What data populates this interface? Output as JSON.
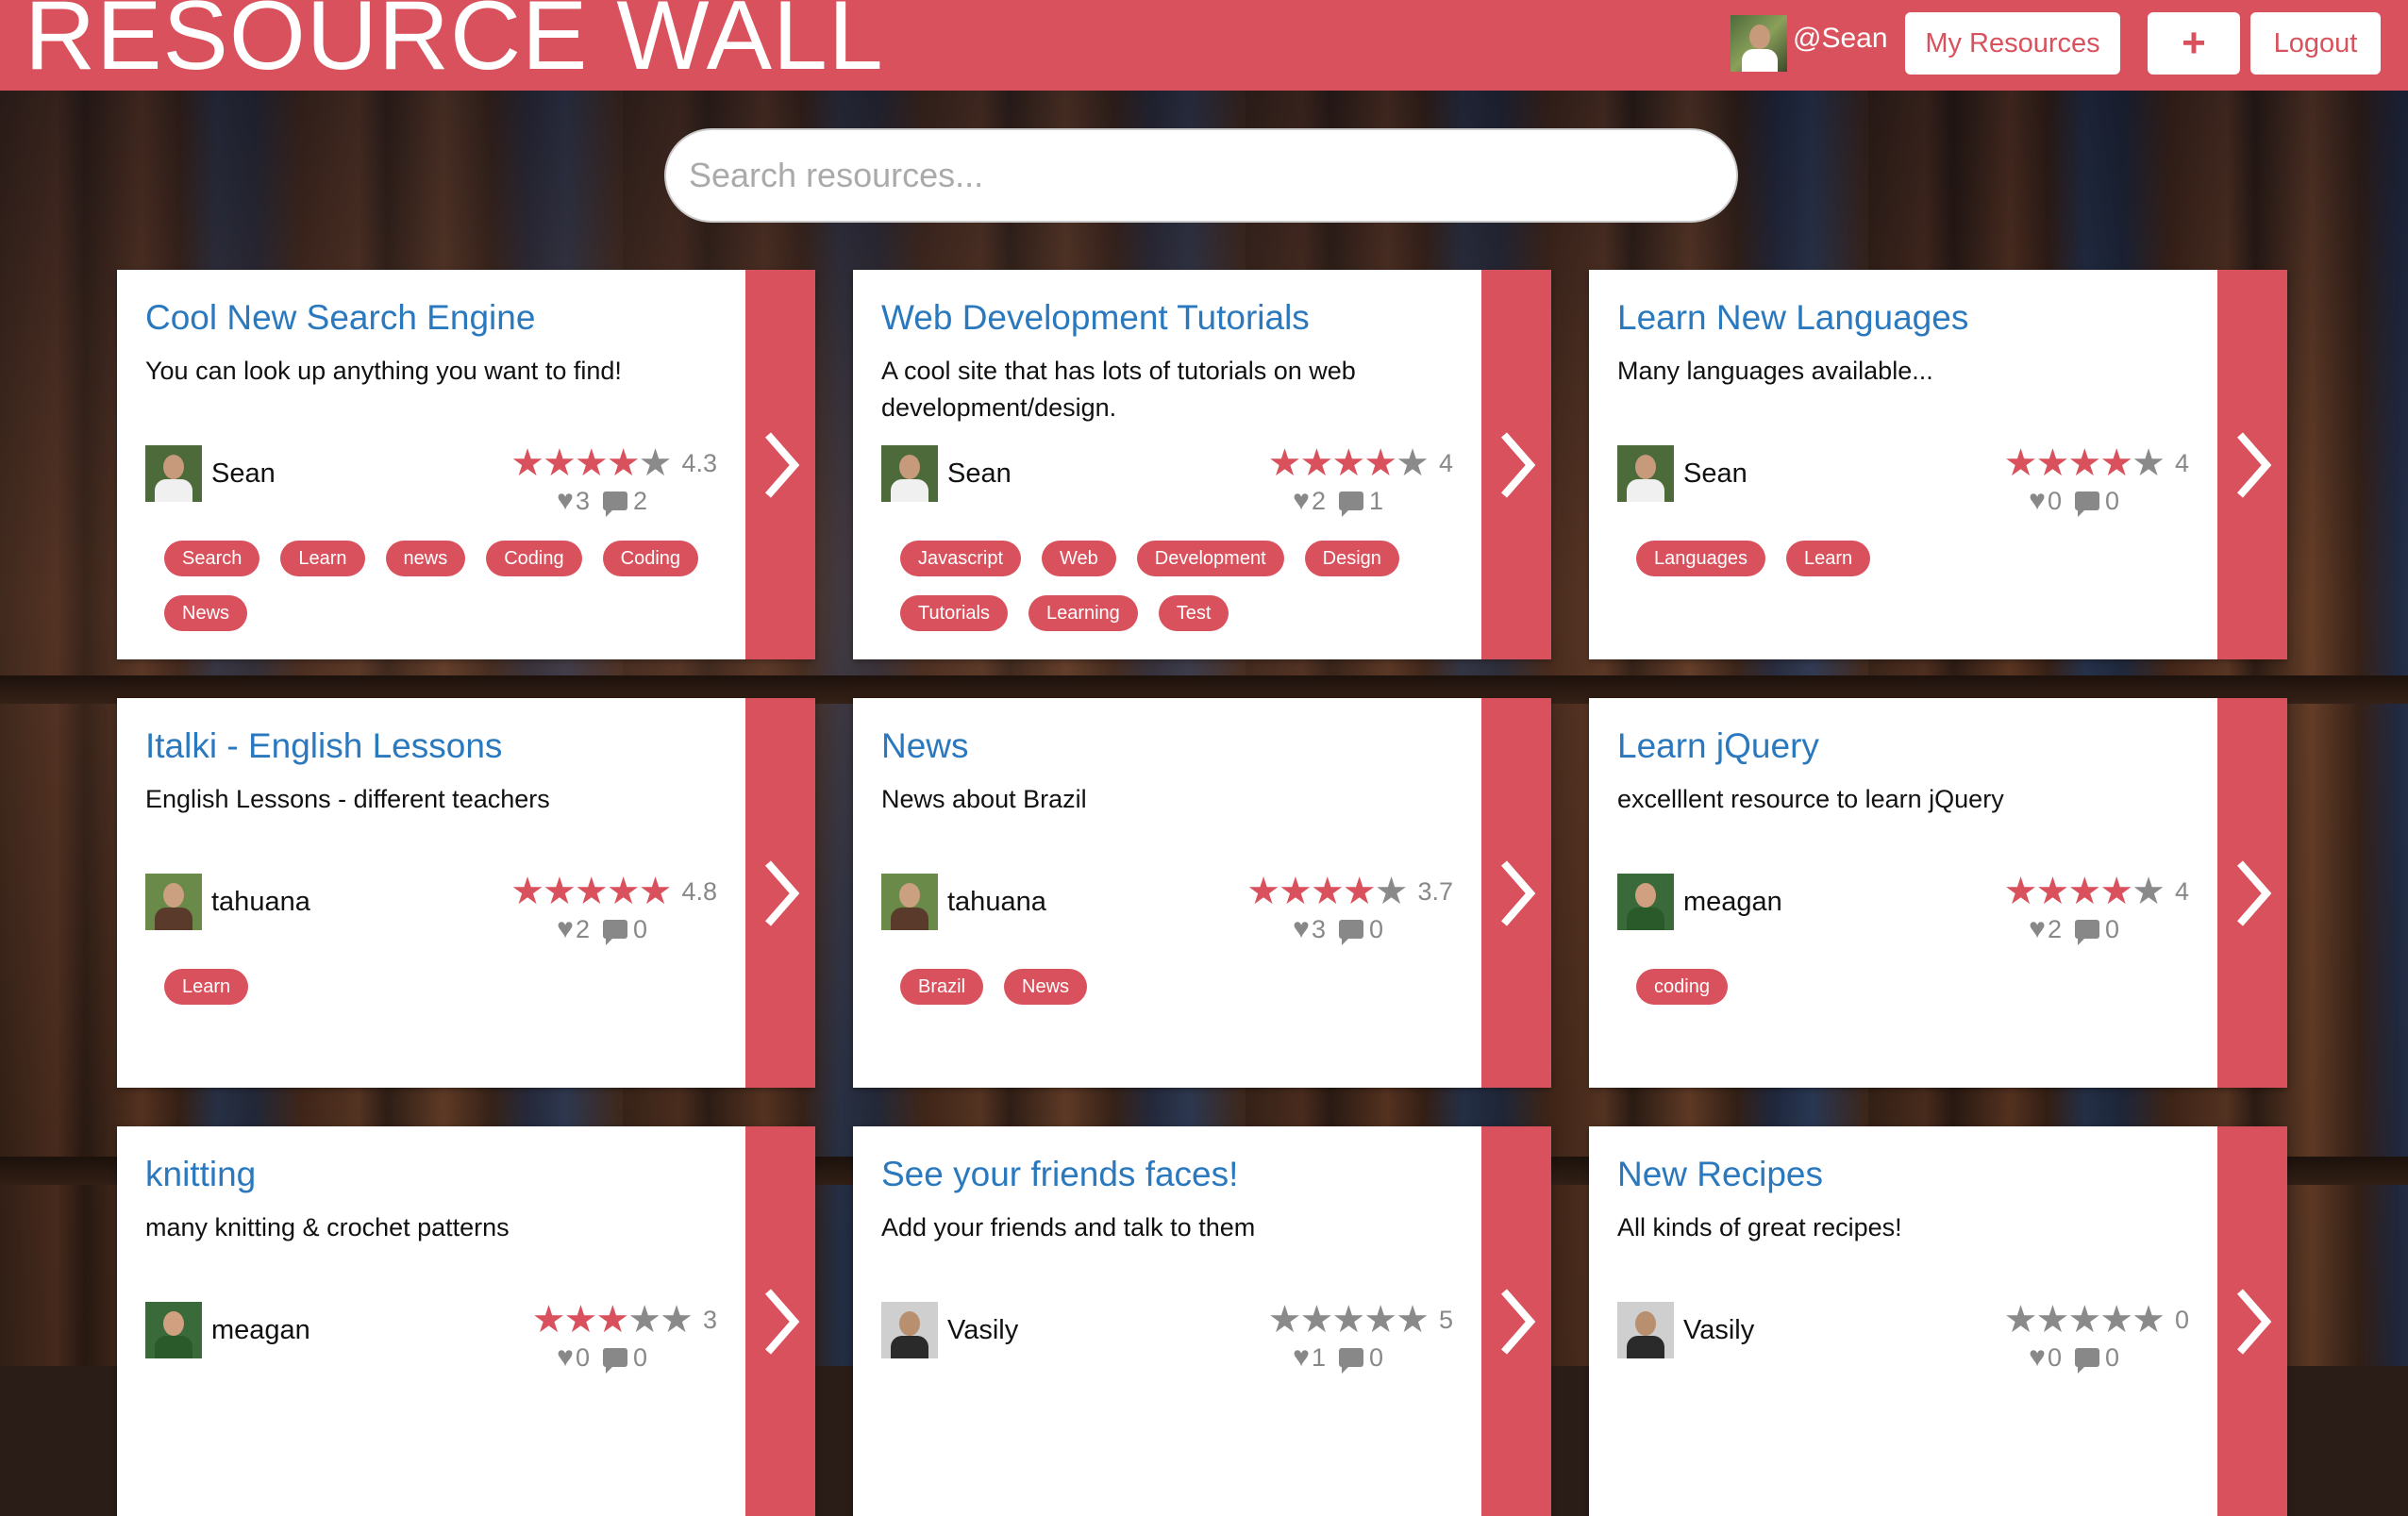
{
  "header": {
    "brand": "RESOURCE WALL",
    "user_handle": "@Sean",
    "my_resources_label": "My Resources",
    "add_label": "+",
    "logout_label": "Logout",
    "accent_color": "#d9515c"
  },
  "search": {
    "placeholder": "Search resources..."
  },
  "cards": [
    {
      "title": "Cool New Search Engine",
      "description": "You can look up anything you want to find!",
      "author": "Sean",
      "stars": 4,
      "rating": "4.3",
      "likes": "3",
      "comments": "2",
      "tags": [
        "Search",
        "Learn",
        "news",
        "Coding",
        "Coding",
        "News"
      ]
    },
    {
      "title": "Web Development Tutorials",
      "description": "A cool site that has lots of tutorials on web development/design.",
      "author": "Sean",
      "stars": 4,
      "rating": "4",
      "likes": "2",
      "comments": "1",
      "tags": [
        "Javascript",
        "Web",
        "Development",
        "Design",
        "Tutorials",
        "Learning",
        "Test"
      ]
    },
    {
      "title": "Learn New Languages",
      "description": "Many languages available...",
      "author": "Sean",
      "stars": 4,
      "rating": "4",
      "likes": "0",
      "comments": "0",
      "tags": [
        "Languages",
        "Learn"
      ]
    },
    {
      "title": "Italki - English Lessons",
      "description": "English Lessons - different teachers",
      "author": "tahuana",
      "stars": 5,
      "rating": "4.8",
      "likes": "2",
      "comments": "0",
      "tags": [
        "Learn"
      ]
    },
    {
      "title": "News",
      "description": "News about Brazil",
      "author": "tahuana",
      "stars": 4,
      "rating": "3.7",
      "likes": "3",
      "comments": "0",
      "tags": [
        "Brazil",
        "News"
      ]
    },
    {
      "title": "Learn jQuery",
      "description": "excelllent resource to learn jQuery",
      "author": "meagan",
      "stars": 4,
      "rating": "4",
      "likes": "2",
      "comments": "0",
      "tags": [
        "coding"
      ]
    },
    {
      "title": "knitting",
      "description": "many knitting & crochet patterns",
      "author": "meagan",
      "stars": 3,
      "rating": "3",
      "likes": "0",
      "comments": "0",
      "tags": []
    },
    {
      "title": "See your friends faces!",
      "description": "Add your friends and talk to them",
      "author": "Vasily",
      "stars": 0,
      "rating": "5",
      "likes": "1",
      "comments": "0",
      "tags": []
    },
    {
      "title": "New Recipes",
      "description": "All kinds of great recipes!",
      "author": "Vasily",
      "stars": 0,
      "rating": "0",
      "likes": "0",
      "comments": "0",
      "tags": []
    }
  ]
}
